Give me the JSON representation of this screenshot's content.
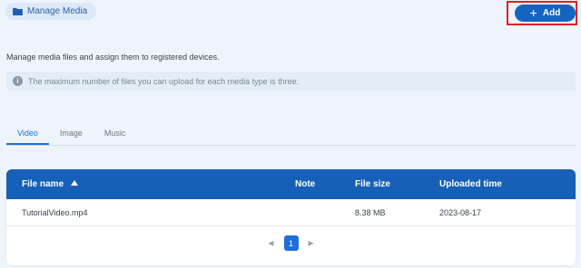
{
  "breadcrumb": {
    "label": "Manage Media",
    "icon": "folder-icon"
  },
  "actions": {
    "add_label": "Add",
    "add_icon": "plus-icon"
  },
  "description": "Manage media files and assign them to registered devices.",
  "info": {
    "icon": "info-icon",
    "text": "The maximum number of files you can upload for each media type is three."
  },
  "tabs": [
    {
      "label": "Video",
      "active": true
    },
    {
      "label": "Image",
      "active": false
    },
    {
      "label": "Music",
      "active": false
    }
  ],
  "table": {
    "columns": {
      "file_name": "File name",
      "note": "Note",
      "file_size": "File size",
      "uploaded_time": "Uploaded time"
    },
    "sort": {
      "column": "file_name",
      "direction": "ascending"
    },
    "rows": [
      {
        "file_name": "TutorialVideo.mp4",
        "note": "",
        "file_size": "8.38 MB",
        "uploaded_time": "2023-08-17"
      }
    ]
  },
  "pagination": {
    "current_page": "1"
  },
  "colors": {
    "primary": "#1565c0",
    "header": "#1760b8",
    "active_tab": "#1e6fd9",
    "background": "#eef4fc",
    "highlight": "#e02020"
  }
}
